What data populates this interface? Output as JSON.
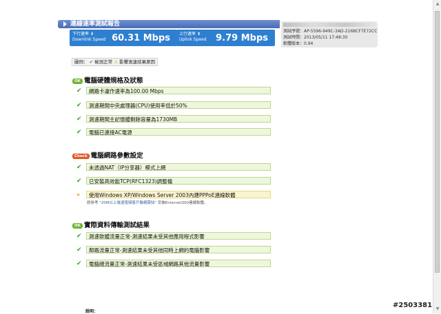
{
  "header": {
    "title": "連線速率測試報告"
  },
  "speeds": {
    "download": {
      "label_cn": "下行速率",
      "label_en": "Downlink Speed",
      "value": "60.31 Mbps"
    },
    "upload": {
      "label_cn": "上行速率",
      "label_en": "Uplink Speed",
      "value": "9.79 Mbps"
    }
  },
  "info_panel": {
    "lines": [
      "測試序號：AP-5596-949C-3AD-216BCF7E72CC",
      "測試時間：2013/05/11 17:48:30",
      "軟體版本：0.94"
    ]
  },
  "legend": {
    "prefix": "圖例：",
    "normal": "檢測正常",
    "warning": "影響測速結果原因"
  },
  "sections": [
    {
      "badge": "OK",
      "title": "電腦硬體規格及狀態",
      "items": [
        {
          "text": "網路卡運作速率為100.00 Mbps"
        },
        {
          "text": "測速期間中央處理器(CPU)使用率低於50%"
        },
        {
          "text": "測速期間主記憶體剩餘容量為1730MB"
        },
        {
          "text": "電腦已連接AC電源"
        }
      ]
    },
    {
      "badge": "Check",
      "title": "電腦網路參數設定",
      "items": [
        {
          "text": "未透過NAT（IP分享器）模式上網"
        },
        {
          "text": "已安裝高效能TCP(RFC1323)調整檔"
        },
        {
          "text": "使用Windows XP/Windows Server 2003內建PPPoE連線軟體",
          "note_prefix": "請參考",
          "note_link": "\"20M以上電速寬頻客戶聯網需知\"",
          "note_suffix": "安裝Enternet300連線軟體。"
        }
      ]
    },
    {
      "badge": "OK",
      "title": "實際資料傳輸測試結果",
      "items": [
        {
          "text": "測速軟體流量正常-測速結果未受其他應用程式影響"
        },
        {
          "text": "鄰路流量正常-測速結果未受其他同時上網的電腦影響"
        },
        {
          "text": "電腦總流量正常-測速結果未受區域網路其他流量影響"
        }
      ]
    }
  ],
  "footer": {
    "label": "說明："
  },
  "watermark": "#2503381"
}
